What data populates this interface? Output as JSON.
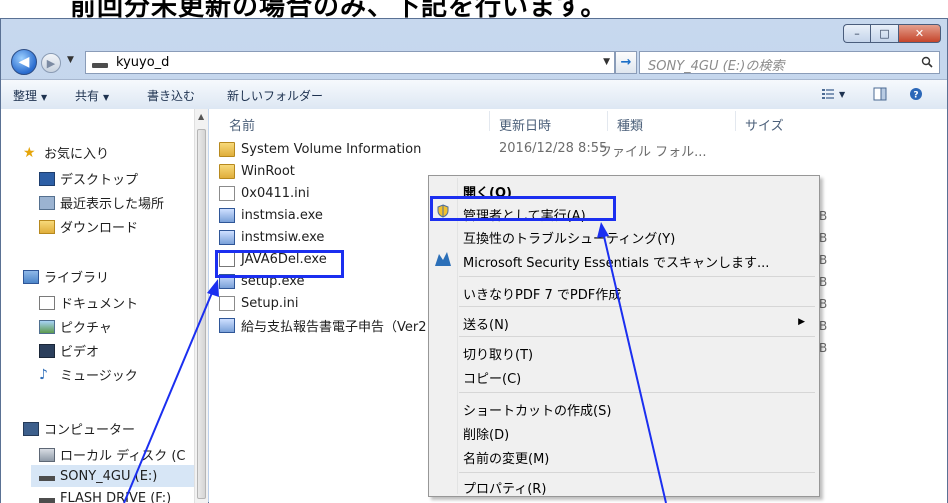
{
  "banner": {
    "text": "前回分未更新の場合のみ、下記を行います。"
  },
  "window": {
    "address": "kyuyo_d",
    "search_placeholder": "SONY_4GU (E:)の検索"
  },
  "toolbar": {
    "organize": "整理",
    "share": "共有",
    "burn": "書き込む",
    "new_folder": "新しいフォルダー"
  },
  "nav_pane": {
    "favorites": "お気に入り",
    "desktop": "デスクトップ",
    "recent": "最近表示した場所",
    "downloads": "ダウンロード",
    "library": "ライブラリ",
    "documents": "ドキュメント",
    "pictures": "ピクチャ",
    "videos": "ビデオ",
    "music": "ミュージック",
    "computer": "コンピューター",
    "local_disk": "ローカル ディスク (C",
    "sony": "SONY_4GU (E:)",
    "flash": "FLASH DRIVE (F:)"
  },
  "columns": {
    "name": "名前",
    "date": "更新日時",
    "type": "種類",
    "size": "サイズ"
  },
  "files": [
    {
      "name": "System Volume Information",
      "date": "2016/12/28 8:55",
      "type": "ファイル フォル..."
    },
    {
      "name": "WinRoot"
    },
    {
      "name": "0x0411.ini"
    },
    {
      "name": "instmsia.exe"
    },
    {
      "name": "instmsiw.exe"
    },
    {
      "name": "JAVA6Del.exe"
    },
    {
      "name": "setup.exe"
    },
    {
      "name": "Setup.ini"
    },
    {
      "name": "給与支払報告書電子申告（Ver2"
    }
  ],
  "size_suffix": "B",
  "context_menu": {
    "open": "開く(O)",
    "run_as_admin": "管理者として実行(A)...",
    "troubleshoot": "互換性のトラブルシューティング(Y)",
    "mse": "Microsoft Security Essentials でスキャンします...",
    "pdf": "いきなりPDF 7 でPDF作成",
    "send_to": "送る(N)",
    "cut": "切り取り(T)",
    "copy": "コピー(C)",
    "shortcut": "ショートカットの作成(S)",
    "delete": "削除(D)",
    "rename": "名前の変更(M)",
    "properties": "プロパティ(R)"
  },
  "colors": {
    "highlight": "#1b2ff0",
    "selection": "#d7e6f6"
  }
}
